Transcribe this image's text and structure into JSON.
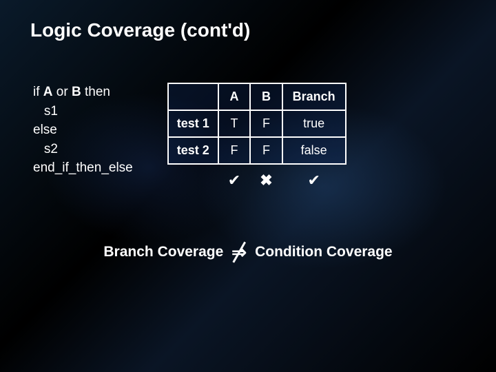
{
  "title": "Logic Coverage (cont'd)",
  "code": {
    "l1_pre": "if ",
    "l1_a": "A",
    "l1_mid": " or ",
    "l1_b": "B",
    "l1_post": " then",
    "l2": "   s1",
    "l3": "else",
    "l4": "   s2",
    "l5": "end_if_then_else"
  },
  "table": {
    "headers": {
      "c0": "",
      "c1": "A",
      "c2": "B",
      "c3": "Branch"
    },
    "rows": [
      {
        "label": "test 1",
        "a": "T",
        "b": "F",
        "branch": "true"
      },
      {
        "label": "test 2",
        "a": "F",
        "b": "F",
        "branch": "false"
      }
    ],
    "marks": {
      "a": "✔",
      "b": "✖",
      "branch": "✔"
    }
  },
  "conclusion": {
    "left": "Branch Coverage",
    "op": "⇒",
    "right": "Condition Coverage"
  }
}
